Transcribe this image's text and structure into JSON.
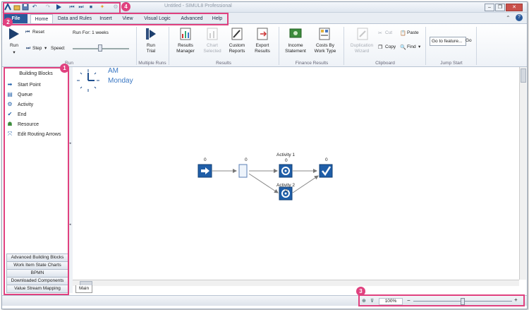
{
  "window": {
    "title": "Untitled - SIMUL8 Professional",
    "controls": [
      "minimize",
      "restore",
      "close"
    ]
  },
  "quick_access": {
    "icons": [
      "simul8-logo-icon",
      "open-icon",
      "save-icon",
      "undo-icon",
      "redo-icon",
      "run-icon",
      "rewind-icon",
      "step-icon",
      "stop-icon",
      "settings-icon"
    ]
  },
  "tabs": [
    {
      "label": "File"
    },
    {
      "label": "Home"
    },
    {
      "label": "Data and Rules"
    },
    {
      "label": "Insert"
    },
    {
      "label": "View"
    },
    {
      "label": "Visual Logic"
    },
    {
      "label": "Advanced"
    },
    {
      "label": "Help"
    }
  ],
  "ribbon": {
    "run": {
      "run_label": "Run",
      "reset_label": "Reset",
      "step_label": "Step",
      "speed_label": "Speed:",
      "run_for_label": "Run For: 1 weeks",
      "group_label": "Run"
    },
    "multiple_runs": {
      "button_label": "Run\nTrial",
      "group_label": "Multiple Runs"
    },
    "results": {
      "buttons": [
        "Results\nManager",
        "Chart\nSelected",
        "Custom\nReports",
        "Export\nResults"
      ],
      "group_label": "Results"
    },
    "finance": {
      "buttons": [
        "Income\nStatement",
        "Costs By\nWork Type"
      ],
      "group_label": "Finance Results"
    },
    "clipboard": {
      "duplication_label": "Duplication\nWizard",
      "cut_label": "Cut",
      "copy_label": "Copy",
      "paste_label": "Paste",
      "find_label": "Find",
      "group_label": "Clipboard"
    },
    "jump": {
      "input_value": "Go to feature...",
      "go_label": "Go",
      "group_label": "Jump Start"
    }
  },
  "left_panel": {
    "title": "Building Blocks",
    "items": [
      {
        "label": "Start Point",
        "icon": "arrow-right-icon"
      },
      {
        "label": "Queue",
        "icon": "queue-icon"
      },
      {
        "label": "Activity",
        "icon": "gear-icon"
      },
      {
        "label": "End",
        "icon": "checkmark-icon"
      },
      {
        "label": "Resource",
        "icon": "resource-icon"
      },
      {
        "label": "Edit Routing Arrows",
        "icon": "routing-icon"
      }
    ],
    "categories": [
      "Advanced Building Blocks",
      "Work Item State Charts",
      "BPMN",
      "Downloaded Components",
      "Value Stream Mapping"
    ]
  },
  "canvas": {
    "clock_time": "AM",
    "clock_day": "Monday",
    "nodes": [
      {
        "id": "start",
        "count": "0",
        "label": ""
      },
      {
        "id": "queue",
        "count": "0",
        "label": ""
      },
      {
        "id": "activity1",
        "count": "0",
        "label": "Activity 1"
      },
      {
        "id": "activity2",
        "count": "0",
        "label": "Activity 2"
      },
      {
        "id": "end",
        "count": "0",
        "label": ""
      }
    ]
  },
  "sheet_tab": "Main",
  "status": {
    "zoom": "100%",
    "zoom_minus": "−",
    "zoom_plus": "+",
    "zoom_level": 0.5
  },
  "callouts": [
    "1",
    "2",
    "3",
    "4"
  ],
  "colors": {
    "accent": "#2a5a9b",
    "callout": "#e0417f",
    "clock_text": "#3b78c4"
  }
}
